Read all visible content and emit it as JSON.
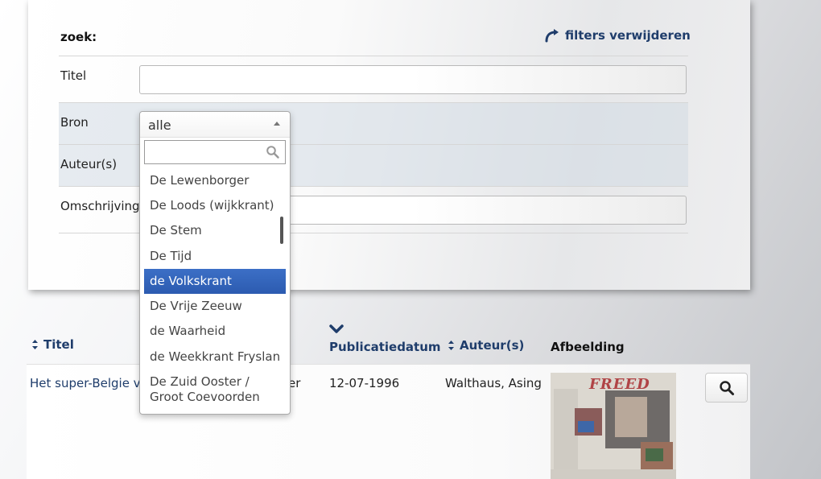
{
  "search": {
    "heading": "zoek:",
    "reset_label": "filters verwijderen",
    "fields": {
      "title_label": "Titel",
      "source_label": "Bron",
      "authors_label": "Auteur(s)",
      "description_label": "Omschrijving"
    }
  },
  "source_dropdown": {
    "selected": "alle",
    "search_value": "",
    "options": [
      "De Lewenborger",
      "De Loods (wijkkrant)",
      "De Stem",
      "De Tijd",
      "de Volkskrant",
      "De Vrije Zeeuw",
      "de Waarheid",
      "de Weekkrant Fryslan",
      "De Zuid Ooster / Groot Coevoorden"
    ],
    "highlighted": "de Volkskrant"
  },
  "results": {
    "columns": {
      "title": "Titel",
      "date": "Publicatiedatum",
      "authors": "Auteur(s)",
      "image": "Afbeelding"
    },
    "rows": [
      {
        "title": "Het super-Belgie va",
        "source_fragment": "er",
        "date": "12-07-1996",
        "authors": "Walthaus, Asing",
        "thumb_caption": "FREED"
      }
    ]
  },
  "colors": {
    "link": "#1f3d6b",
    "highlight": "#3366bb"
  }
}
